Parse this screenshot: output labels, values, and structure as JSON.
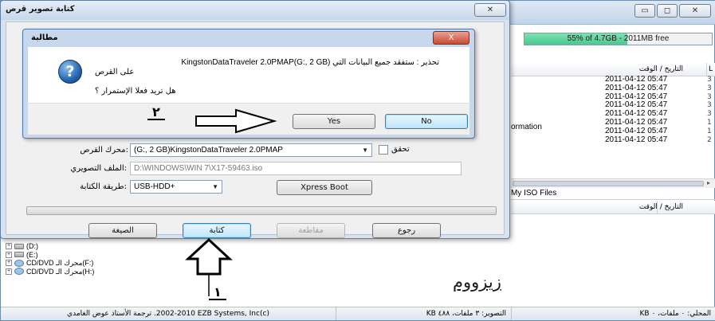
{
  "main_window": {
    "capacity_text": "55% of 4.7GB - 2011MB free",
    "capacity_percent": 55,
    "column_date_header": "التاريخ / الوقت",
    "column_size_header": "L",
    "file_dates": [
      "2011-04-12 05:47",
      "2011-04-12 05:47",
      "2011-04-12 05:47",
      "2011-04-12 05:47",
      "2011-04-12 05:47",
      "2011-04-12 05:47",
      "2011-04-12 05:47",
      "2011-04-12 05:47"
    ],
    "file_sizes": [
      "3",
      "3",
      "3",
      "3",
      "3",
      "1",
      "1",
      "2"
    ],
    "partial_name": "ormation",
    "lower_panel_title": "My ISO Files",
    "lower_date_header": "التاريخ / الوقت",
    "tree_items": [
      "(D:)",
      "(E:)",
      "CD/DVD محرك الـ(F:)",
      "CD/DVD محرك الـ(H:)"
    ],
    "watermark": "زيزووم",
    "status": {
      "credit": "(c)2002-2010 EZB Systems, Inc. ترجمة الأستاذ عوض الغامدي",
      "image_info": "التصوير: ٣ ملفات، ٤٨٨ KB",
      "local_info": "المحلي: ٠ ملفات، ٠ KB"
    }
  },
  "burn_dialog": {
    "title": "كتابة تصوير قرص",
    "drive_label": ":محرك القرص",
    "drive_value": "(G:, 2 GB)KingstonDataTraveler 2.0PMAP",
    "verify_label": "تحقق",
    "image_file_label": ":الملف التصويري",
    "image_file_value": "D:\\WINDOWS\\WIN 7\\X17-59463.iso",
    "method_label": ":طريقة الكتابة",
    "method_value": "USB-HDD+",
    "xpress_label": "Xpress Boot",
    "format_label": "الصيغة",
    "write_label": "كتابة",
    "abort_label": "مقاطعة",
    "back_label": "رجوع"
  },
  "message_box": {
    "title": "مطالبة",
    "close_label": "X",
    "line1": "تحذير : ستفقد جميع البيانات التي (G:, 2 GB)KingstonDataTraveler 2.0PMAP",
    "line2": "على القرص",
    "question": "هل تريد فعلا الإستمرار ؟",
    "yes_label": "Yes",
    "no_label": "No",
    "icon": "question-icon"
  },
  "annotations": {
    "step1": "١",
    "step2": "٢"
  }
}
